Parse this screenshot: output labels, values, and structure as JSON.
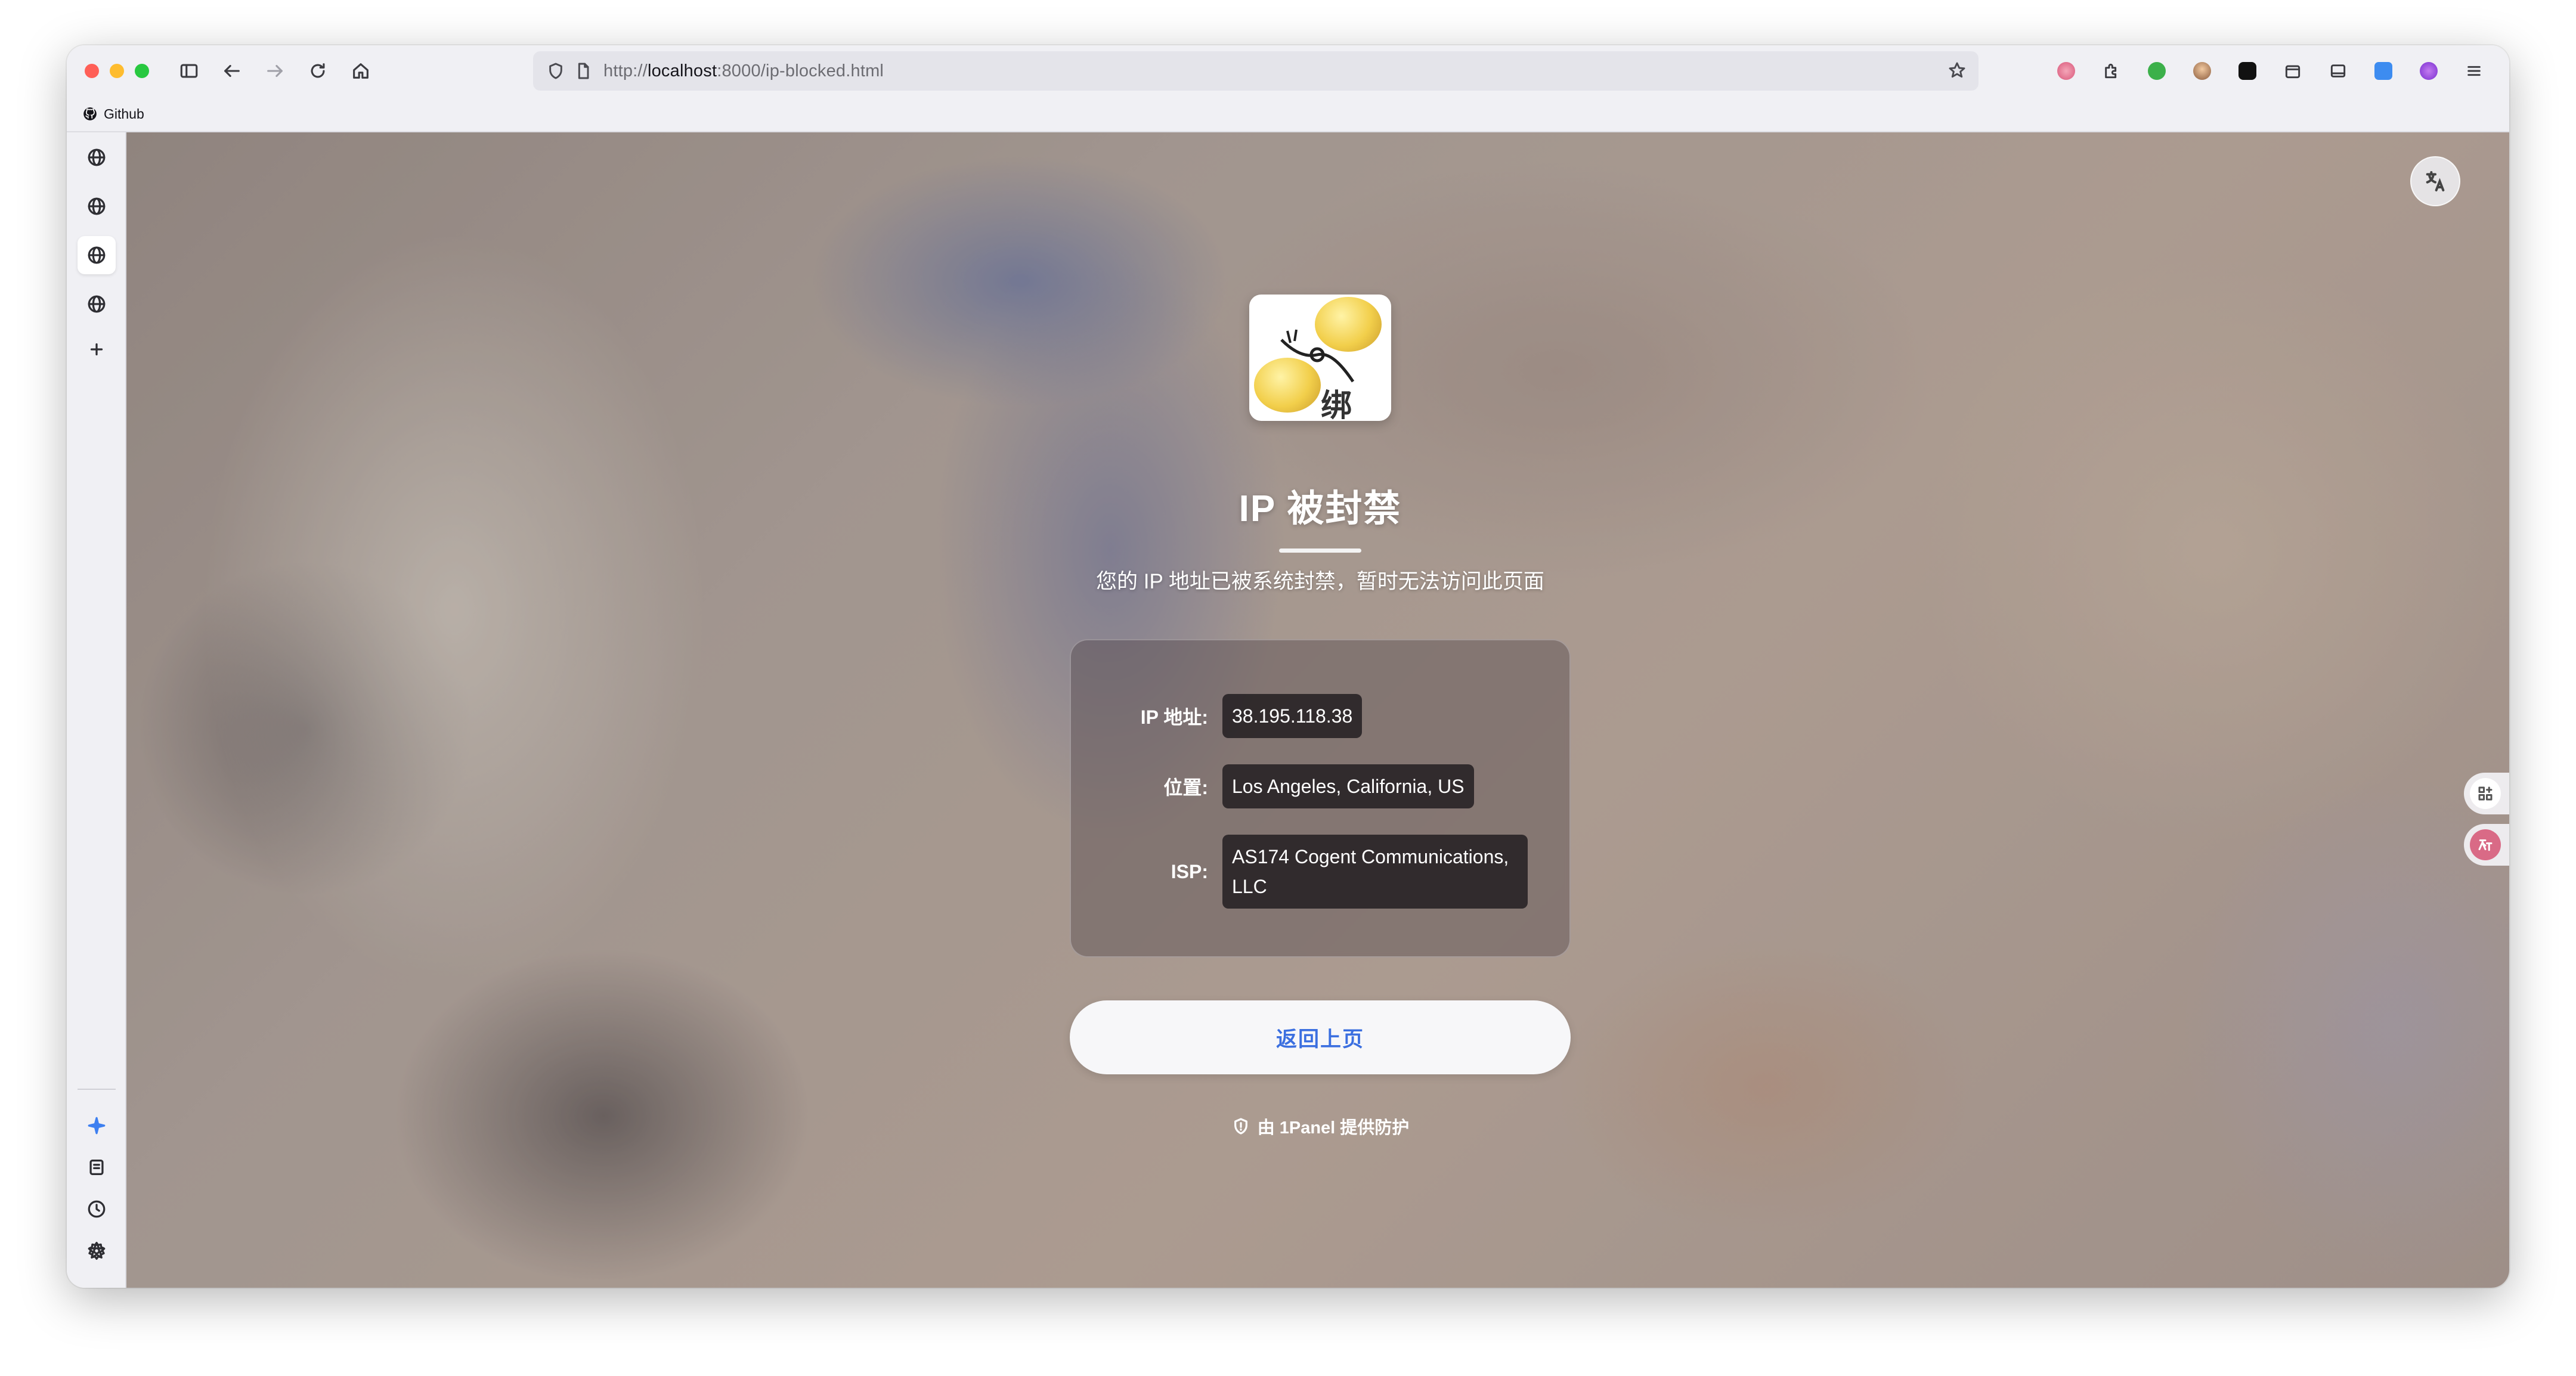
{
  "browser": {
    "url": {
      "scheme": "http://",
      "host": "localhost",
      "rest": ":8000/ip-blocked.html"
    },
    "bookmarks": [
      {
        "label": "Github",
        "icon": "github-icon"
      }
    ],
    "toolbar_icons": [
      "sidebar-toggle-icon",
      "back-icon",
      "forward-icon",
      "reload-icon",
      "home-icon"
    ],
    "extension_icons": [
      "extension-pink-icon",
      "puzzle-icon",
      "extension-green-n-icon",
      "extension-avatar-icon",
      "extension-black-icon",
      "extension-box-icon",
      "extension-tab-icon",
      "extension-blue-icon",
      "extension-purple-icon",
      "menu-icon"
    ],
    "sidebar_icons": [
      "globe-icon",
      "globe-icon",
      "globe-icon",
      "globe-icon",
      "plus-icon",
      "sparkle-icon",
      "download-icon",
      "history-icon",
      "star-icon",
      "settings-icon"
    ]
  },
  "page": {
    "title": "IP 被封禁",
    "subtitle": "您的 IP 地址已被系统封禁，暂时无法访问此页面",
    "info": [
      {
        "label": "IP 地址:",
        "value": "38.195.118.38"
      },
      {
        "label": "位置:",
        "value": "Los Angeles, California, US"
      },
      {
        "label": "ISP:",
        "value": "AS174 Cogent Communications, LLC"
      }
    ],
    "back_button": "返回上页",
    "footer": "由 1Panel 提供防护",
    "accent_color": "#3b6fe0"
  }
}
